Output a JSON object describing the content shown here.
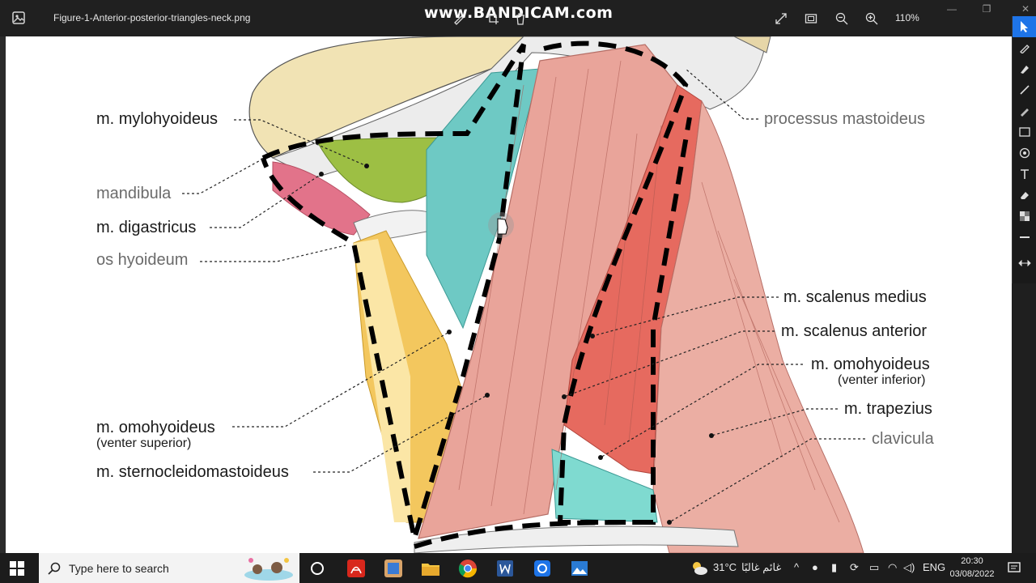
{
  "window": {
    "title": "Figure-1-Anterior-posterior-triangles-neck.png",
    "watermark": "www.BANDICAM.com",
    "zoom": "110%"
  },
  "figure": {
    "labels_left": {
      "mylohyoideus": "m. mylohyoideus",
      "mandibula": "mandibula",
      "digastricus": "m. digastricus",
      "hyoideum": "os hyoideum",
      "omohyoideus_sup": "m. omohyoideus",
      "omohyoideus_sup_sub": "(venter superior)",
      "sternocleido": "m. sternocleidomastoideus"
    },
    "labels_right": {
      "mastoideus": "processus mastoideus",
      "scalenus_medius": "m. scalenus medius",
      "scalenus_anterior": "m. scalenus anterior",
      "omohyoideus_inf": "m. omohyoideus",
      "omohyoideus_inf_sub": "(venter inferior)",
      "trapezius": "m. trapezius",
      "clavicula": "clavicula"
    }
  },
  "taskbar": {
    "search_placeholder": "Type here to search",
    "weather": "31°C",
    "weather_text": "غائم غالبًا",
    "language": "ENG",
    "time": "20:30",
    "date": "03/08/2022"
  },
  "colors": {
    "accent": "#1e74e8",
    "muscle": "#e9a49a",
    "muscle_dark": "#e66a5f",
    "teal": "#6ec9c4",
    "green": "#9dbf44",
    "yellow": "#f3c75e",
    "bone": "#f3e6bf"
  },
  "icons": [
    "photo-app-icon",
    "draw-icon",
    "crop-icon",
    "delete-icon",
    "expand-icon",
    "fit-icon",
    "zoom-out-icon",
    "zoom-in-icon",
    "start-icon",
    "search-icon",
    "task-view-icon",
    "acrobat-icon",
    "app-icon",
    "file-explorer-icon",
    "chrome-icon",
    "word-icon",
    "app2-icon",
    "photos-icon"
  ]
}
